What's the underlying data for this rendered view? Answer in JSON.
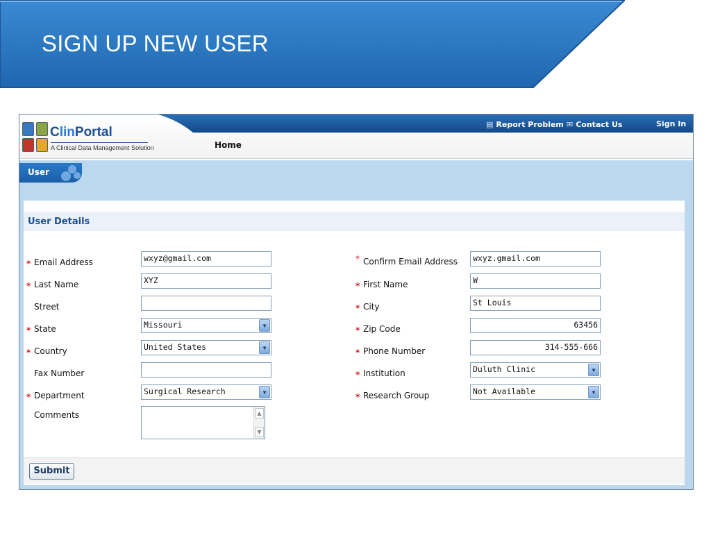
{
  "slide": {
    "title": "SIGN UP NEW USER",
    "banner_color": "#2a78c2"
  },
  "app": {
    "logo": {
      "name_prefix": "C",
      "name_mid": "lin",
      "name_suffix": "Portal",
      "tagline": "A Clinical Data Management Solution"
    },
    "top_links": {
      "report_problem": "Report Problem",
      "contact_us": "Contact Us",
      "sign_in": "Sign In"
    },
    "icons": {
      "report_problem": "document-icon",
      "contact_us": "envelope-icon"
    },
    "nav": {
      "home": "Home"
    },
    "tab": {
      "label": "User"
    }
  },
  "form": {
    "section_title": "User Details",
    "left": [
      {
        "label": "Email Address",
        "required": true,
        "type": "text",
        "value": "wxyz@gmail.com"
      },
      {
        "label": "Last Name",
        "required": true,
        "type": "text",
        "value": "XYZ"
      },
      {
        "label": "Street",
        "required": false,
        "type": "text",
        "value": ""
      },
      {
        "label": "State",
        "required": true,
        "type": "select",
        "value": "Missouri"
      },
      {
        "label": "Country",
        "required": true,
        "type": "select",
        "value": "United States"
      },
      {
        "label": "Fax Number",
        "required": false,
        "type": "text",
        "value": ""
      },
      {
        "label": "Department",
        "required": true,
        "type": "select",
        "value": "Surgical Research"
      },
      {
        "label": "Comments",
        "required": false,
        "type": "textarea",
        "value": ""
      }
    ],
    "right": [
      {
        "label": "Confirm Email Address",
        "required": true,
        "type": "text",
        "value": "wxyz.gmail.com"
      },
      {
        "label": "First Name",
        "required": true,
        "type": "text",
        "value": "W"
      },
      {
        "label": "City",
        "required": true,
        "type": "text",
        "value": "St Louis"
      },
      {
        "label": "Zip Code",
        "required": true,
        "type": "text",
        "value": "63456"
      },
      {
        "label": "Phone Number",
        "required": true,
        "type": "text",
        "value": "314-555-666"
      },
      {
        "label": "Institution",
        "required": true,
        "type": "select",
        "value": "Duluth Clinic"
      },
      {
        "label": "Research Group",
        "required": true,
        "type": "select",
        "value": "Not Available"
      }
    ],
    "required_mark": "*",
    "submit": "Submit"
  }
}
